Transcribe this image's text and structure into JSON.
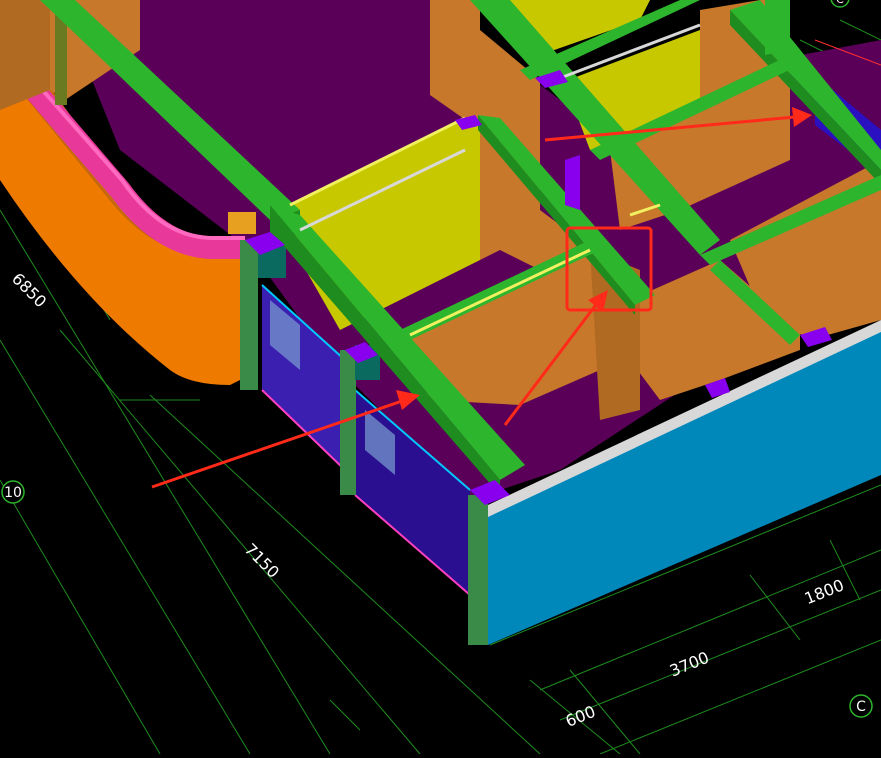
{
  "viewport": {
    "background": "#000000",
    "grid_color": "#1e8c1e"
  },
  "dimensions": {
    "left_1": "6850",
    "left_2": "7150",
    "bottom_1": "600",
    "bottom_2": "3700",
    "bottom_3": "1800"
  },
  "axis_markers": {
    "left_label": "10",
    "bottom_right_label": "C",
    "top_right_label": "C"
  },
  "colors": {
    "beam_green": "#2db52d",
    "wall_orange": "#c8782a",
    "wall_yellow": "#c8c800",
    "floor_purple": "#5a0058",
    "slab_orange": "#ef7a00",
    "pipe_pink": "#e8389a",
    "facade_blue": "#0088bb",
    "window_blue": "#3a1fb0",
    "column_purple": "#8800ee",
    "arrow_red": "#ff2a1a"
  },
  "annotations": {
    "arrow_count": 3,
    "highlight_box": "red rectangle around beam joint"
  }
}
